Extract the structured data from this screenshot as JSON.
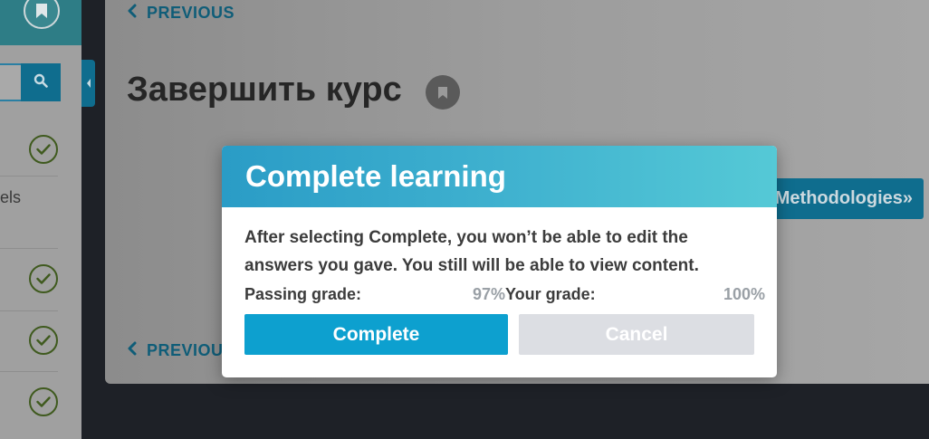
{
  "background": {
    "previous_label": "PREVIOUS",
    "previous_label_bottom": "PREVIOUS",
    "page_title": "Завершить курс",
    "methodologies_button": "Methodologies»",
    "sidebar_partial_text": "els"
  },
  "icons": {
    "bookmark": "bookmark-icon",
    "search": "search-icon",
    "collapse": "chevron-left-icon",
    "check": "check-circle-icon",
    "previous": "chevron-left-icon"
  },
  "modal": {
    "title": "Complete learning",
    "message": "After selecting Complete, you won’t be able to edit the answers you gave. You still will be able to view content.",
    "passing_grade_label": "Passing grade:",
    "passing_grade_value": "97%",
    "your_grade_label": "Your grade:",
    "your_grade_value": "100%",
    "complete_button": "Complete",
    "cancel_button": "Cancel"
  },
  "colors": {
    "accent": "#0da0cf",
    "header_gradient_start": "#2a9cc6",
    "header_gradient_end": "#55c9d6",
    "cancel_disabled": "#dcdee3",
    "link_dark": "#0f5d78"
  }
}
